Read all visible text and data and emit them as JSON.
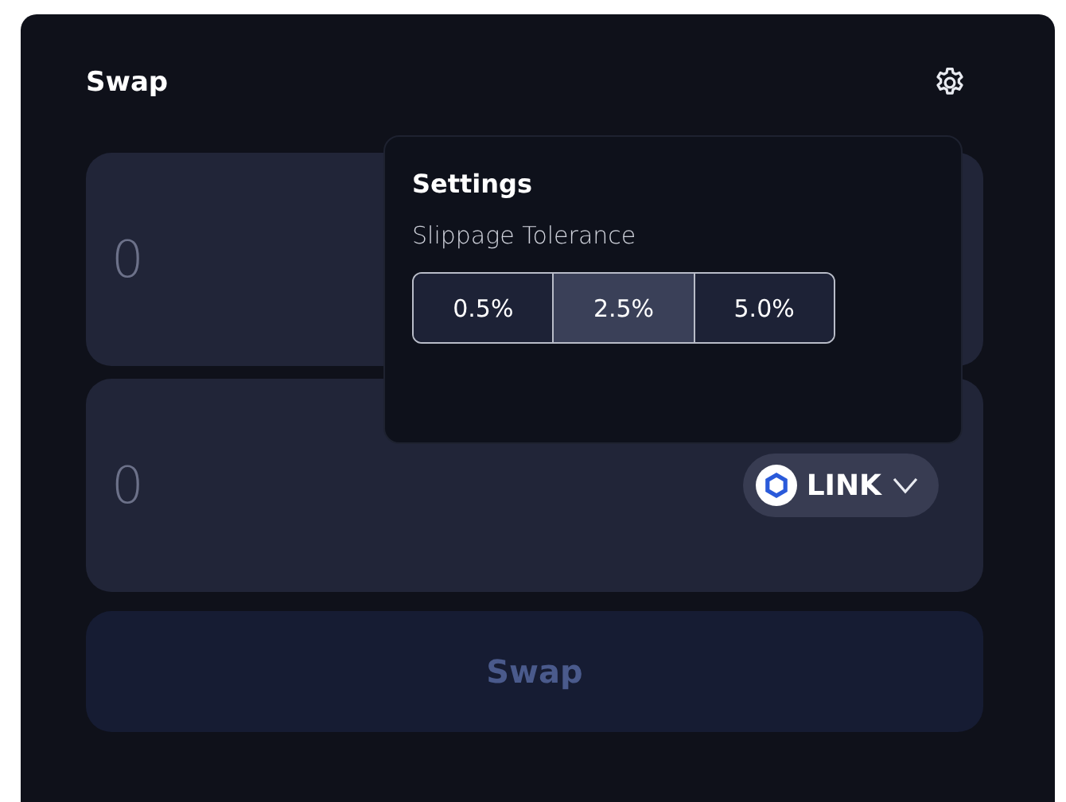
{
  "title": "Swap",
  "input_panels": [
    {
      "placeholder": "0"
    },
    {
      "placeholder": "0",
      "token": {
        "symbol": "LINK"
      }
    }
  ],
  "swap_button": {
    "label": "Swap",
    "disabled": true
  },
  "settings_popover": {
    "title": "Settings",
    "slippage_label": "Slippage Tolerance",
    "options": [
      {
        "label": "0.5%",
        "selected": false
      },
      {
        "label": "2.5%",
        "selected": true
      },
      {
        "label": "5.0%",
        "selected": false
      }
    ]
  }
}
